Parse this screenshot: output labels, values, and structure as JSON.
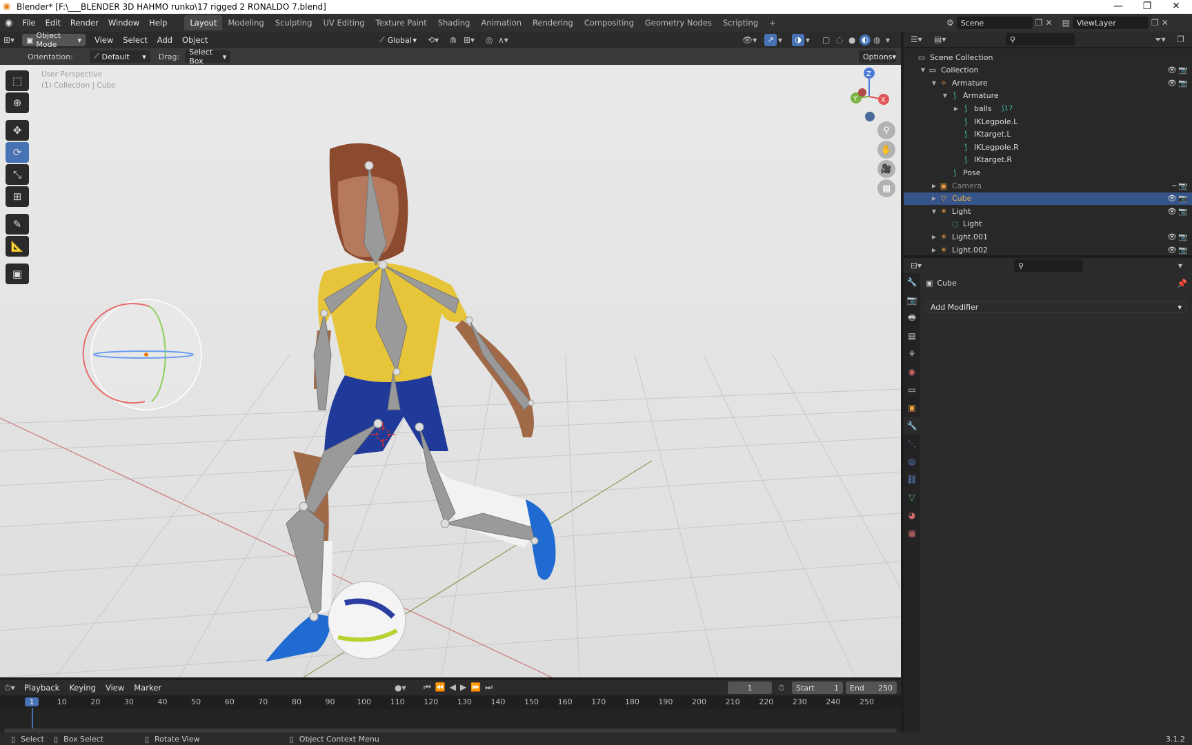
{
  "window": {
    "title": "Blender* [F:\\___BLENDER 3D HAHMO runko\\17 rigged 2 RONALDO 7.blend]"
  },
  "menu": [
    "File",
    "Edit",
    "Render",
    "Window",
    "Help"
  ],
  "workspaces": [
    "Layout",
    "Modeling",
    "Sculpting",
    "UV Editing",
    "Texture Paint",
    "Shading",
    "Animation",
    "Rendering",
    "Compositing",
    "Geometry Nodes",
    "Scripting"
  ],
  "active_workspace": "Layout",
  "scene": {
    "name": "Scene",
    "view_layer": "ViewLayer"
  },
  "viewport_header": {
    "mode": "Object Mode",
    "menus": [
      "View",
      "Select",
      "Add",
      "Object"
    ],
    "transform": "Global"
  },
  "tool_settings": {
    "orientation_label": "Orientation:",
    "orientation": "Default",
    "drag_label": "Drag:",
    "drag": "Select Box",
    "options": "Options"
  },
  "viewport": {
    "view_name": "User Perspective",
    "collection_info": "(1) Collection | Cube",
    "gizmo_axes": [
      "Z",
      "Y",
      "X"
    ]
  },
  "outliner": {
    "rows": [
      {
        "label": "Scene Collection",
        "depth": 0,
        "icon": "collection-icon",
        "color": "#dddddd"
      },
      {
        "label": "Collection",
        "depth": 1,
        "icon": "collection-icon",
        "color": "#dddddd",
        "tw": "▼"
      },
      {
        "label": "Armature",
        "depth": 2,
        "icon": "armature-icon",
        "color": "#dddddd",
        "tw": "▼"
      },
      {
        "label": "Armature",
        "depth": 3,
        "icon": "armature-data-icon",
        "color": "#dddddd",
        "tw": "▼"
      },
      {
        "label": "balls",
        "depth": 4,
        "icon": "bone-icon",
        "color": "#dddddd",
        "tw": "▶",
        "extra": "17"
      },
      {
        "label": "IKLegpole.L",
        "depth": 4,
        "icon": "bone-icon",
        "color": "#dddddd"
      },
      {
        "label": "IKtarget.L",
        "depth": 4,
        "icon": "bone-icon",
        "color": "#dddddd"
      },
      {
        "label": "IKLegpole.R",
        "depth": 4,
        "icon": "bone-icon",
        "color": "#dddddd"
      },
      {
        "label": "IKtarget.R",
        "depth": 4,
        "icon": "bone-icon",
        "color": "#dddddd"
      },
      {
        "label": "Pose",
        "depth": 3,
        "icon": "pose-icon",
        "color": "#dddddd"
      },
      {
        "label": "Camera",
        "depth": 2,
        "icon": "camera-icon",
        "color": "#8a8a8a",
        "tw": "▶"
      },
      {
        "label": "Cube",
        "depth": 2,
        "icon": "mesh-icon",
        "color": "#f0b04a",
        "tw": "▶",
        "selected": true
      },
      {
        "label": "Light",
        "depth": 2,
        "icon": "light-icon",
        "color": "#dddddd",
        "tw": "▼"
      },
      {
        "label": "Light",
        "depth": 3,
        "icon": "light-data-icon",
        "color": "#dddddd"
      },
      {
        "label": "Light.001",
        "depth": 2,
        "icon": "light-icon",
        "color": "#dddddd",
        "tw": "▶"
      },
      {
        "label": "Light.002",
        "depth": 2,
        "icon": "light-icon",
        "color": "#dddddd",
        "tw": "▶"
      }
    ]
  },
  "properties": {
    "object_name": "Cube",
    "add_modifier": "Add Modifier"
  },
  "timeline": {
    "menus": [
      "Playback",
      "Keying",
      "View",
      "Marker"
    ],
    "current_frame": "1",
    "start_label": "Start",
    "start": "1",
    "end_label": "End",
    "end": "250",
    "ticks": [
      "1",
      "10",
      "20",
      "30",
      "40",
      "50",
      "60",
      "70",
      "80",
      "90",
      "100",
      "110",
      "120",
      "130",
      "140",
      "150",
      "160",
      "170",
      "180",
      "190",
      "200",
      "210",
      "220",
      "230",
      "240",
      "250"
    ]
  },
  "status": {
    "select": "Select",
    "box_select": "Box Select",
    "rotate_view": "Rotate View",
    "context_menu": "Object Context Menu",
    "version": "3.1.2"
  },
  "colors": {
    "accent": "#4772b3",
    "selected_row": "#34548a",
    "header": "#303030"
  }
}
